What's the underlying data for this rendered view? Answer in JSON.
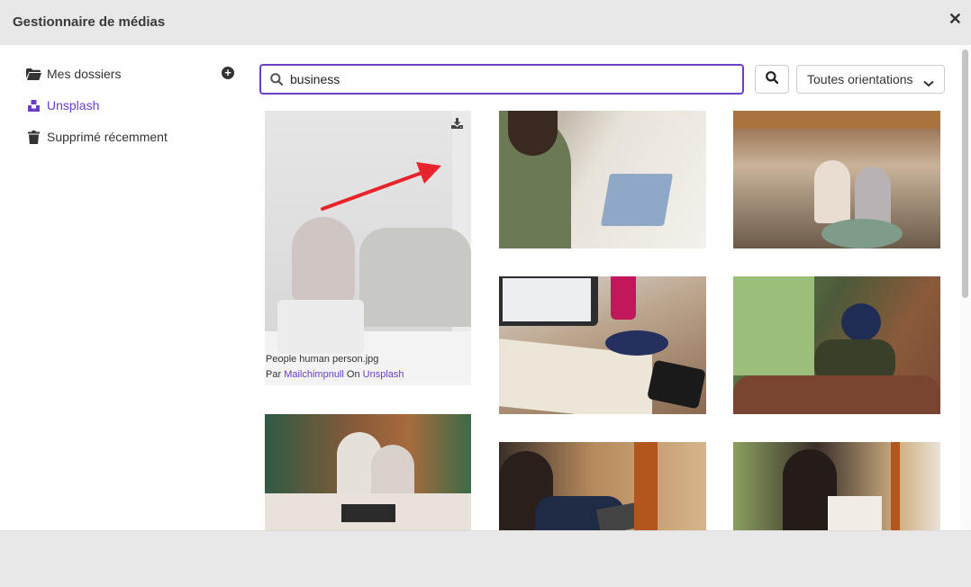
{
  "window": {
    "title": "Gestionnaire de médias",
    "close_glyph": "✕"
  },
  "sidebar": {
    "items": [
      {
        "label": "Mes dossiers",
        "icon": "folder-icon",
        "active": false
      },
      {
        "label": "Unsplash",
        "icon": "unsplash-icon",
        "active": true
      },
      {
        "label": "Supprimé récemment",
        "icon": "trash-icon",
        "active": false
      }
    ],
    "add_glyph": "+"
  },
  "search": {
    "value": "business",
    "placeholder": ""
  },
  "orientation": {
    "selected": "Toutes orientations"
  },
  "photos": [
    {
      "filename": "People human person.jpg",
      "by_label": "Par",
      "author": "Mailchimpnull",
      "on_label": "On",
      "source": "Unsplash"
    }
  ],
  "colors": {
    "accent": "#6b3fc4",
    "annotation_arrow": "#e8232b"
  }
}
